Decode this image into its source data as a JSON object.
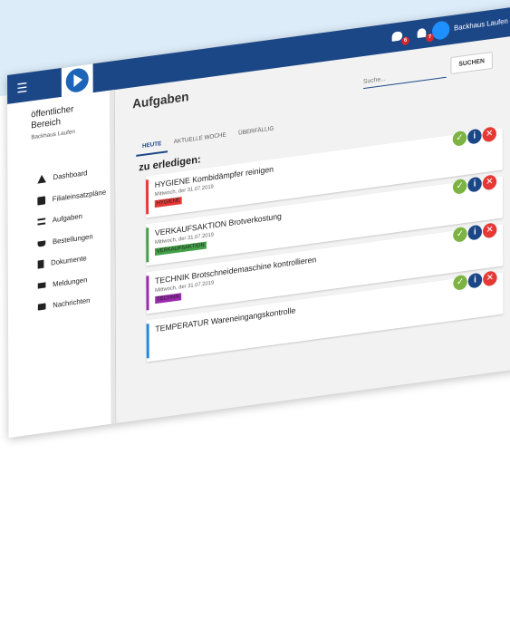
{
  "header": {
    "user_name": "Backhaus Laufen",
    "chat_badge": "6",
    "bell_badge": "7",
    "colors": {
      "bar": "#1c4787",
      "accent": "#1e90ff"
    }
  },
  "sidebar": {
    "area_title": "öffentlicher Bereich",
    "area_subtitle": "Backhaus Laufen",
    "items": [
      {
        "label": "Dashboard",
        "icon": "home-icon"
      },
      {
        "label": "Filialeinsatzpläne",
        "icon": "calendar-icon"
      },
      {
        "label": "Aufgaben",
        "icon": "tasks-icon"
      },
      {
        "label": "Bestellungen",
        "icon": "cart-icon"
      },
      {
        "label": "Dokumente",
        "icon": "document-icon"
      },
      {
        "label": "Meldungen",
        "icon": "flag-icon"
      },
      {
        "label": "Nachrichten",
        "icon": "message-icon"
      }
    ]
  },
  "main": {
    "title": "Aufgaben",
    "search_placeholder": "Suche...",
    "search_button": "SUCHEN",
    "tabs": [
      {
        "label": "HEUTE",
        "active": true
      },
      {
        "label": "AKTUELLE WOCHE",
        "active": false
      },
      {
        "label": "ÜBERFÄLLIG",
        "active": false
      }
    ],
    "section_title": "zu erledigen:",
    "tasks": [
      {
        "title": "HYGIENE Kombidämpfer reinigen",
        "date": "Mittwoch, der 31.07.2019",
        "tag": "HYGIENE",
        "color": "#e53935"
      },
      {
        "title": "VERKAUFSAKTION Brotverkostung",
        "date": "Mittwoch, der 31.07.2019",
        "tag": "VERKAUFSAKTION",
        "color": "#43a047"
      },
      {
        "title": "TECHNIK Brotschneidemaschine kontrollieren",
        "date": "Mittwoch, der 31.07.2019",
        "tag": "TECHNIK",
        "color": "#9c27b0"
      },
      {
        "title": "TEMPERATUR Wareneingangskontrolle",
        "date": "",
        "tag": "",
        "color": "#1e88e5"
      }
    ],
    "actions": [
      {
        "symbol": "✓",
        "icon": "check-icon",
        "color": "#7cb342"
      },
      {
        "symbol": "i",
        "icon": "info-icon",
        "color": "#1c4787"
      },
      {
        "symbol": "✕",
        "icon": "close-icon",
        "color": "#e53935"
      }
    ]
  }
}
